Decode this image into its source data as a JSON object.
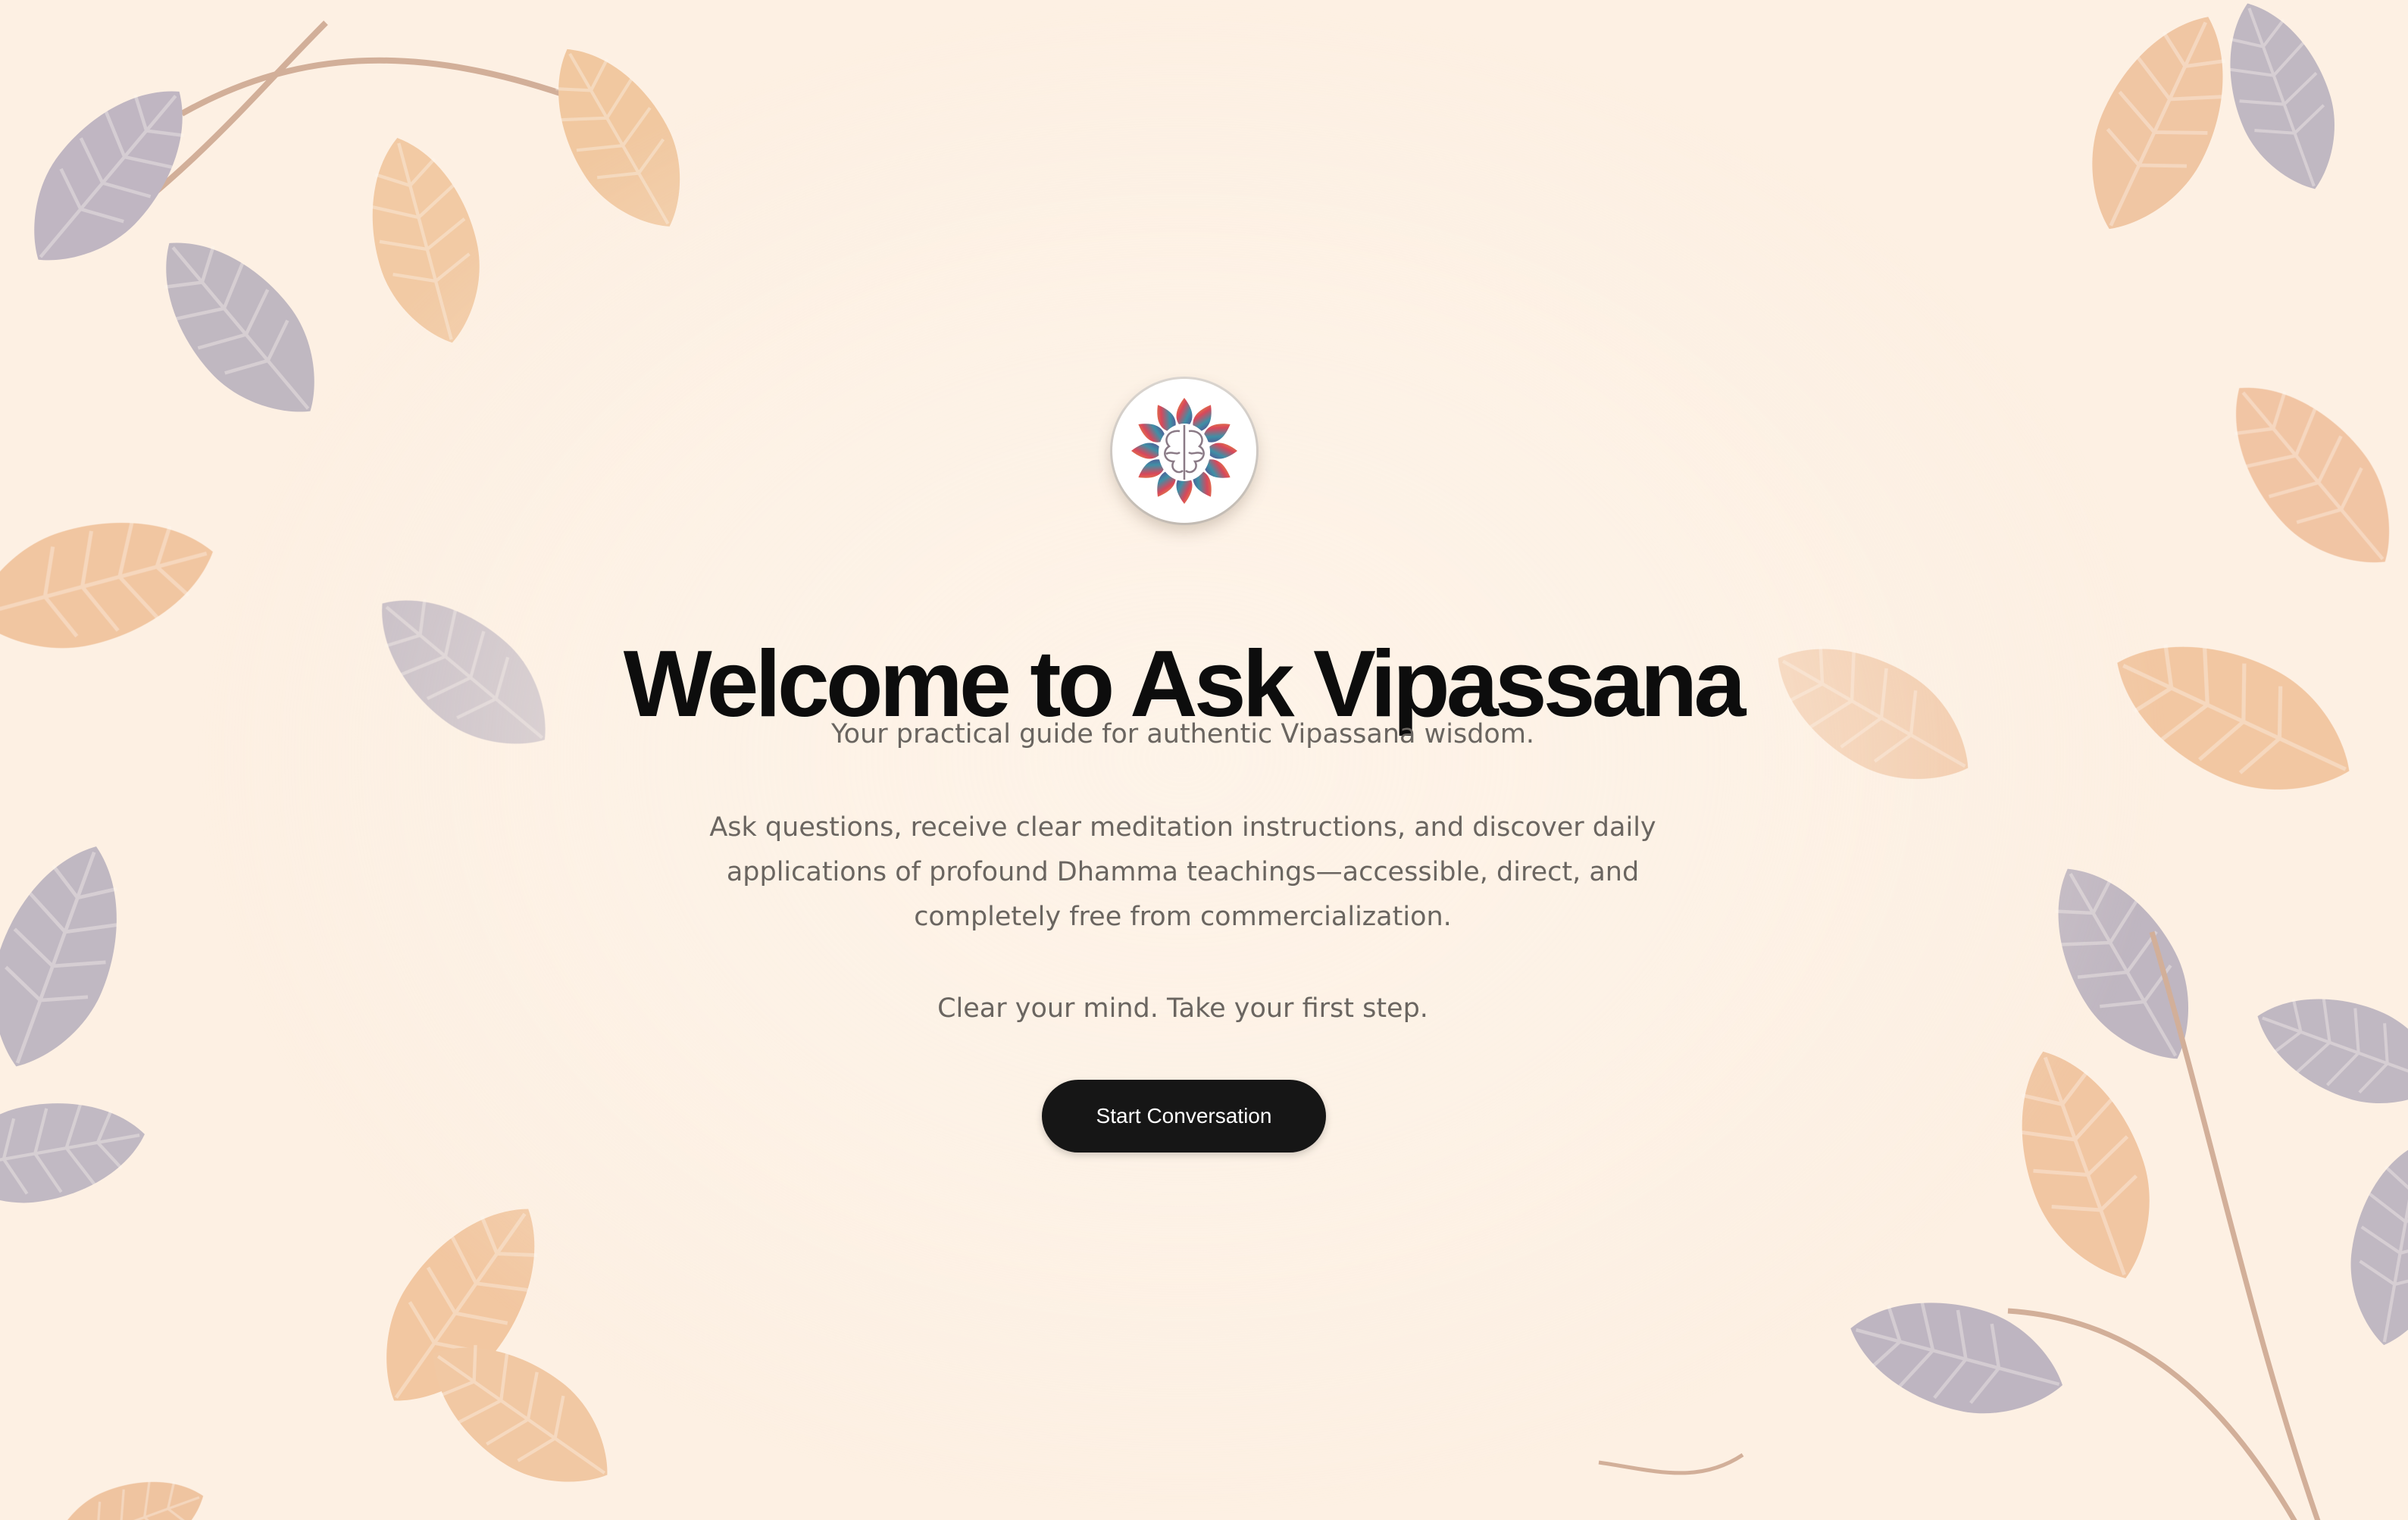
{
  "hero": {
    "title": "Welcome to Ask Vipassana",
    "tagline": "Your practical guide for authentic Vipassana wisdom.",
    "description": "Ask questions, receive clear meditation instructions, and discover daily applications of profound Dhamma teachings—accessible, direct, and completely free from commercialization.",
    "call_to_action": "Clear your mind. Take your first step.",
    "start_button_label": "Start Conversation"
  },
  "logo": {
    "icon": "brain-lotus-logo-icon"
  },
  "background": {
    "icon": "autumn-leaves-background",
    "base_color": "#fdf0e3"
  },
  "colors": {
    "title": "#0d0d0d",
    "body_text": "#6a6560",
    "button_bg": "#161616",
    "button_text": "#ffffff"
  }
}
